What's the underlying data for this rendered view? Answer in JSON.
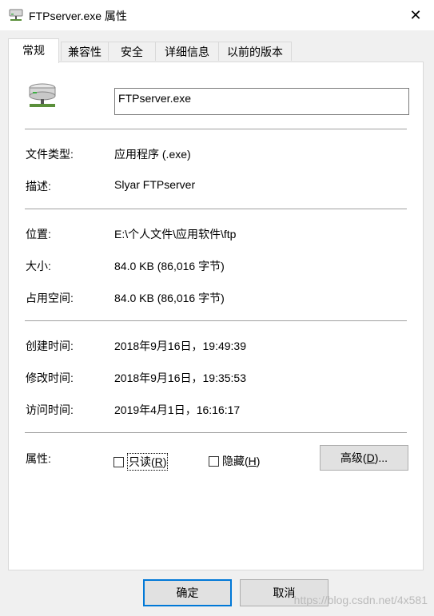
{
  "window": {
    "title": "FTPserver.exe 属性",
    "close_glyph": "✕"
  },
  "tabs": [
    {
      "label": "常规"
    },
    {
      "label": "兼容性"
    },
    {
      "label": "安全"
    },
    {
      "label": "详细信息"
    },
    {
      "label": "以前的版本"
    }
  ],
  "file": {
    "name": "FTPserver.exe"
  },
  "info": {
    "type_label": "文件类型:",
    "type_value": "应用程序 (.exe)",
    "desc_label": "描述:",
    "desc_value": "Slyar FTPserver",
    "location_label": "位置:",
    "location_value": "E:\\个人文件\\应用软件\\ftp",
    "size_label": "大小:",
    "size_value": "84.0 KB (86,016 字节)",
    "disk_label": "占用空间:",
    "disk_value": "84.0 KB (86,016 字节)",
    "created_label": "创建时间:",
    "created_value": "2018年9月16日，19:49:39",
    "modified_label": "修改时间:",
    "modified_value": "2018年9月16日，19:35:53",
    "accessed_label": "访问时间:",
    "accessed_value": "2019年4月1日，16:16:17"
  },
  "attributes": {
    "label": "属性:",
    "readonly": {
      "text": "只读(",
      "key": "R",
      "tail": ")",
      "checked": false
    },
    "hidden": {
      "text": "隐藏(",
      "key": "H",
      "tail": ")",
      "checked": false
    },
    "advanced": {
      "text": "高级(",
      "key": "D",
      "tail": ")..."
    }
  },
  "buttons": {
    "ok": "确定",
    "cancel": "取消"
  },
  "watermark": "https://blog.csdn.net/4x581"
}
